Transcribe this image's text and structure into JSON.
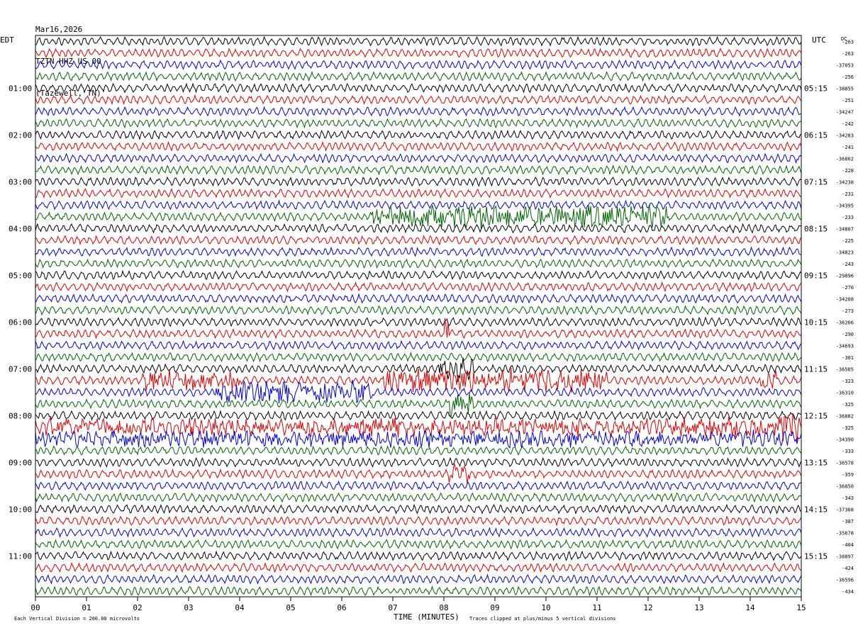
{
  "header": {
    "date": "Mar16,2026",
    "station": "TZTN HHZ US 00",
    "location": "(Tazewell, TN)"
  },
  "left_axis_title": "EDT",
  "right_axis_title": "UTC",
  "dc_title": "DC",
  "footer": {
    "scale_note": "Each Vertical Division =  200.00 microvolts",
    "xlabel": "TIME (MINUTES)",
    "clip_note": "Traces clipped at plus/minus 5 vertical divisions"
  },
  "colors": {
    "trace_cycle": [
      "#000000",
      "#e00000",
      "#0000e0",
      "#006400"
    ]
  },
  "chart_data": {
    "type": "line",
    "title": "TZTN HHZ US 00 (Tazewell, TN) Mar16,2026",
    "xlabel": "TIME (MINUTES)",
    "xlim": [
      0,
      15
    ],
    "x_ticks": [
      "00",
      "01",
      "02",
      "03",
      "04",
      "05",
      "06",
      "07",
      "08",
      "09",
      "10",
      "11",
      "12",
      "13",
      "14",
      "15"
    ],
    "rows": 48,
    "row_minutes": 15,
    "left_hour_labels": [
      {
        "row": 4,
        "label": "01:00"
      },
      {
        "row": 8,
        "label": "02:00"
      },
      {
        "row": 12,
        "label": "03:00"
      },
      {
        "row": 16,
        "label": "04:00"
      },
      {
        "row": 20,
        "label": "05:00"
      },
      {
        "row": 24,
        "label": "06:00"
      },
      {
        "row": 28,
        "label": "07:00"
      },
      {
        "row": 32,
        "label": "08:00"
      },
      {
        "row": 36,
        "label": "09:00"
      },
      {
        "row": 40,
        "label": "10:00"
      },
      {
        "row": 44,
        "label": "11:00"
      }
    ],
    "right_hour_labels": [
      {
        "row": 4,
        "label": "05:15"
      },
      {
        "row": 8,
        "label": "06:15"
      },
      {
        "row": 12,
        "label": "07:15"
      },
      {
        "row": 16,
        "label": "08:15"
      },
      {
        "row": 20,
        "label": "09:15"
      },
      {
        "row": 24,
        "label": "10:15"
      },
      {
        "row": 28,
        "label": "11:15"
      },
      {
        "row": 32,
        "label": "12:15"
      },
      {
        "row": 36,
        "label": "13:15"
      },
      {
        "row": 40,
        "label": "14:15"
      },
      {
        "row": 44,
        "label": "15:15"
      }
    ],
    "dc_offsets": [
      "-263",
      "-263",
      "-37053",
      "-256",
      "-38855",
      "-251",
      "-34247",
      "-242",
      "-34283",
      "-241",
      "-36802",
      "-228",
      "-34238",
      "-231",
      "-34395",
      "-233",
      "-34807",
      "-225",
      "-34823",
      "-243",
      "-29896",
      "-270",
      "-34208",
      "-273",
      "-36206",
      "-290",
      "-34693",
      "-301",
      "-36505",
      "-323",
      "-36310",
      "-325",
      "-36882",
      "-325",
      "-34390",
      "-333",
      "-36578",
      "-359",
      "-36850",
      "-343",
      "-37308",
      "-387",
      "-35678",
      "-404",
      "-38897",
      "-424",
      "-36596",
      "-434"
    ],
    "events": [
      {
        "row": 15,
        "start_min": 6.6,
        "end_min": 12.4,
        "strength": 2.2
      },
      {
        "row": 25,
        "start_min": 8.0,
        "end_min": 8.1,
        "strength": 3.5
      },
      {
        "row": 28,
        "start_min": 7.9,
        "end_min": 8.6,
        "strength": 2.5
      },
      {
        "row": 29,
        "start_min": 2.1,
        "end_min": 4.0,
        "strength": 2.0
      },
      {
        "row": 29,
        "start_min": 6.8,
        "end_min": 11.2,
        "strength": 2.3
      },
      {
        "row": 29,
        "start_min": 14.2,
        "end_min": 14.5,
        "strength": 2.0
      },
      {
        "row": 30,
        "start_min": 3.5,
        "end_min": 6.6,
        "strength": 2.0
      },
      {
        "row": 31,
        "start_min": 8.1,
        "end_min": 8.6,
        "strength": 2.5
      },
      {
        "row": 33,
        "start_min": 0.0,
        "end_min": 15.0,
        "strength": 1.6
      },
      {
        "row": 33,
        "start_min": 13.2,
        "end_min": 14.0,
        "strength": 2.4
      },
      {
        "row": 33,
        "start_min": 14.6,
        "end_min": 15.0,
        "strength": 2.4
      },
      {
        "row": 34,
        "start_min": 0.0,
        "end_min": 15.0,
        "strength": 1.4
      },
      {
        "row": 37,
        "start_min": 8.1,
        "end_min": 8.5,
        "strength": 1.8
      }
    ]
  }
}
